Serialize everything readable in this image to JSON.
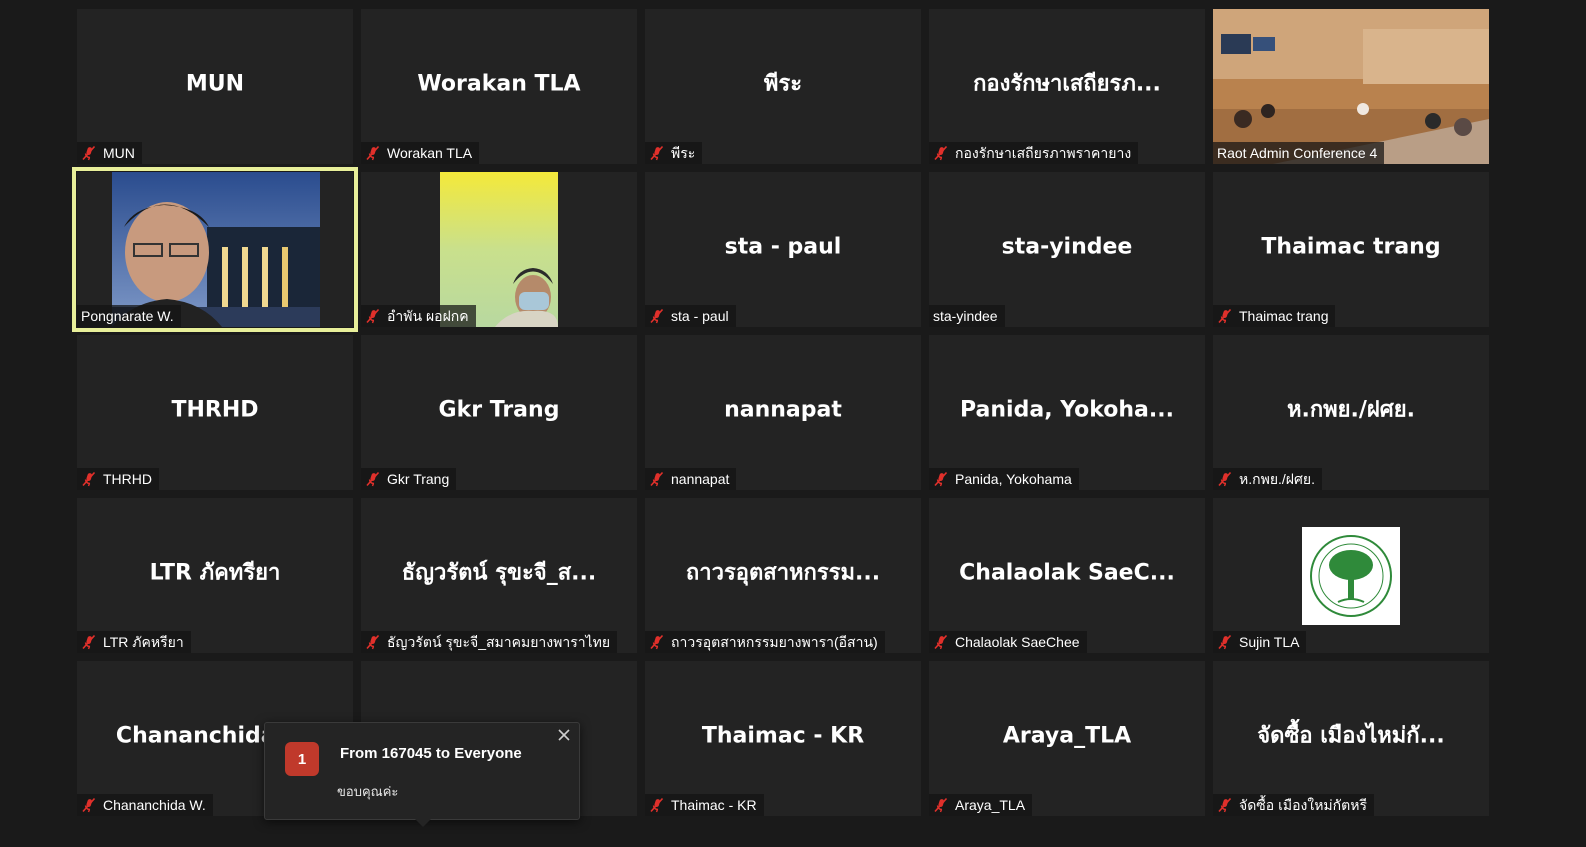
{
  "tiles": [
    {
      "big": "MUN",
      "label": "MUN",
      "muted": true
    },
    {
      "big": "Worakan TLA",
      "label": "Worakan TLA",
      "muted": true
    },
    {
      "big": "พีระ",
      "label": "พีระ",
      "muted": true
    },
    {
      "big": "กองรักษาเสถียรภ...",
      "label": "กองรักษาเสถียรภาพราคายาง",
      "muted": true
    },
    {
      "big": "",
      "label": "Raot Admin Conference 4",
      "muted": false,
      "video": "conference-room"
    },
    {
      "big": "",
      "label": "Pongnarate W.",
      "muted": false,
      "video": "person-glasses",
      "speaking": true
    },
    {
      "big": "",
      "label": "อำพัน ผอฝกค",
      "muted": true,
      "video": "person-mask"
    },
    {
      "big": "sta - paul",
      "label": "sta - paul",
      "muted": true
    },
    {
      "big": "sta-yindee",
      "label": "sta-yindee",
      "muted": false
    },
    {
      "big": "Thaimac trang",
      "label": "Thaimac trang",
      "muted": true
    },
    {
      "big": "THRHD",
      "label": "THRHD",
      "muted": true
    },
    {
      "big": "Gkr Trang",
      "label": "Gkr Trang",
      "muted": true
    },
    {
      "big": "nannapat",
      "label": "nannapat",
      "muted": true
    },
    {
      "big": "Panida,  Yokoha...",
      "label": "Panida, Yokohama",
      "muted": true
    },
    {
      "big": "ห.กพย./ฝศย.",
      "label": "ห.กพย./ฝศย.",
      "muted": true
    },
    {
      "big": "LTR ภัคทรียา",
      "label": "LTR ภัคหรียา",
      "muted": true
    },
    {
      "big": "ธัญวรัตน์ รุขะจี_ส...",
      "label": "ธัญวรัตน์ รุขะจี_สมาคมยางพาราไทย",
      "muted": true
    },
    {
      "big": "ถาวรอุตสาหกรรม...",
      "label": "ถาวรอุตสาหกรรมยางพารา(อีสาน)",
      "muted": true
    },
    {
      "big": "Chalaolak  SaeC...",
      "label": "Chalaolak SaeChee",
      "muted": true
    },
    {
      "big": "",
      "label": "Sujin TLA",
      "muted": true,
      "video": "logo"
    },
    {
      "big": "Chananchida W.",
      "label": "Chananchida W.",
      "muted": true
    },
    {
      "big": "",
      "label": "",
      "muted": false,
      "hidden": true
    },
    {
      "big": "Thaimac - KR",
      "label": "Thaimac - KR",
      "muted": true
    },
    {
      "big": "Araya_TLA",
      "label": "Araya_TLA",
      "muted": true
    },
    {
      "big": "จัดซื้อ เมืองไหม่กั...",
      "label": "จัดซื้อ เมืองใหม่กัตหรี",
      "muted": true
    }
  ],
  "chat": {
    "count": "1",
    "from": "From 167045 to Everyone",
    "message": "ขอบคุณค่ะ"
  },
  "colors": {
    "background": "#1a1a1a",
    "tile": "#232323",
    "speaking_outline": "#e8ef9a",
    "muted_icon": "#e0302b",
    "badge": "#c0392b"
  }
}
